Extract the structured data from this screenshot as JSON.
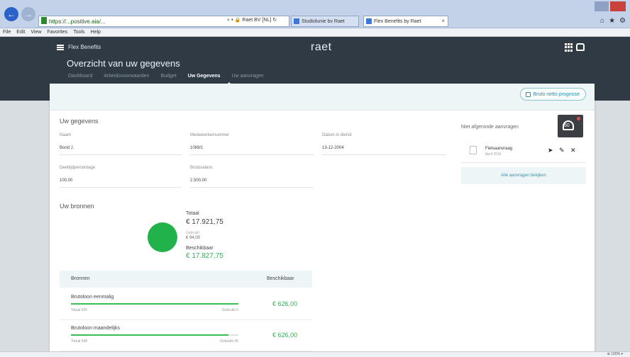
{
  "browser": {
    "address": "https://...positive.aia/...",
    "address_tools": "⌕ ▾ 🔒 Raet BV [NL] ↻",
    "tabs": [
      {
        "label": "Studiolunie bv Raet"
      },
      {
        "label": "Flex Benefits by Raet"
      }
    ],
    "tab_close": "×",
    "back": "←",
    "forward": "→",
    "menu": [
      "File",
      "Edit",
      "View",
      "Favorites",
      "Tools",
      "Help"
    ],
    "chrome_icons": [
      "⌂",
      "★",
      "⚙"
    ],
    "zoom": "⊕ 100% ▾"
  },
  "app": {
    "name": "Flex Benefits",
    "brand": "raet",
    "page_title": "Overzicht van uw gegevens",
    "nav": [
      {
        "label": "Dashboard",
        "active": false
      },
      {
        "label": "Arbeidsvoorwaarden",
        "active": false
      },
      {
        "label": "Budget",
        "active": false
      },
      {
        "label": "Uw Gegevens",
        "active": true
      },
      {
        "label": "Uw aanvragen",
        "active": false
      }
    ]
  },
  "toolbar": {
    "prognose_label": "Bruto netto prognose"
  },
  "gegevens": {
    "title": "Uw gegevens",
    "fields": [
      {
        "label": "Naam",
        "value": "Bond J."
      },
      {
        "label": "Medewerkernummer",
        "value": "1069/1"
      },
      {
        "label": "Datum in dienst",
        "value": "13-12-2004"
      },
      {
        "label": "Deeltijdpercentage",
        "value": "100,00"
      },
      {
        "label": "Brutosalaris",
        "value": "2.500,00"
      }
    ]
  },
  "notifications": {
    "title": "Niet afgeronde aanvragen",
    "count": "60",
    "items": [
      {
        "title": "Fietsaanvraag",
        "date": "April 2016"
      }
    ],
    "actions": {
      "send": "➤",
      "edit": "✎",
      "delete": "✕"
    },
    "see_all_label": "Alle aanvragen bekijken"
  },
  "bronnen": {
    "title": "Uw bronnen",
    "totaal_label": "Totaal",
    "totaal_value": "€ 17.921,75",
    "gebruikt_label": "Gebruikt",
    "gebruikt_value": "€ 94,00",
    "beschikbaar_label": "Beschikbaar",
    "beschikbaar_value": "€ 17.827,75",
    "table": {
      "col_bronnen": "Bronnen",
      "col_beschikbaar": "Beschikbaar",
      "rows": [
        {
          "name": "Brutoloon eenmalig",
          "totaal": "Totaal 626",
          "gebruikt": "Gebruikt 0",
          "amount": "€ 626,00",
          "used_fraction": 1.0
        },
        {
          "name": "Brutoloon maandelijks",
          "totaal": "Totaal 648",
          "gebruikt": "Gebruikt 40",
          "amount": "€ 626,00",
          "used_fraction": 0.94
        }
      ]
    }
  },
  "colors": {
    "header": "#2f3a44",
    "accent": "#35b35a",
    "link": "#3a93a8"
  }
}
